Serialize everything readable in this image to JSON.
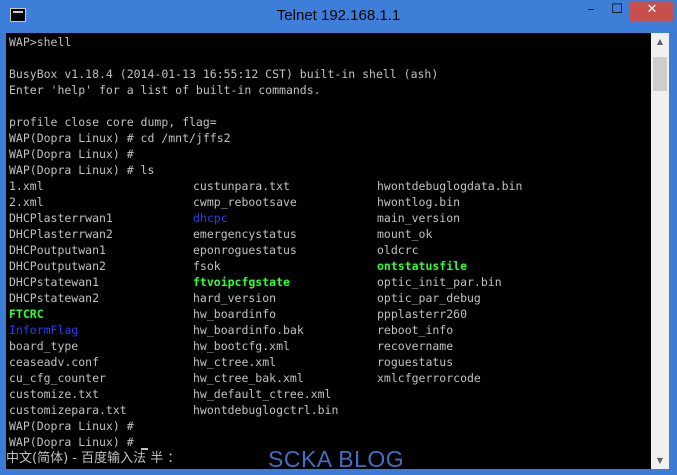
{
  "window": {
    "title": "Telnet 192.168.1.1",
    "minimize_label": "–",
    "maximize_label": "☐",
    "close_label": "✕"
  },
  "terminal": {
    "header_lines": [
      "WAP>shell",
      "",
      "BusyBox v1.18.4 (2014-01-13 16:55:12 CST) built-in shell (ash)",
      "Enter 'help' for a list of built-in commands.",
      "",
      "profile close core dump, flag=",
      "WAP(Dopra Linux) # cd /mnt/jffs2",
      "WAP(Dopra Linux) #",
      "WAP(Dopra Linux) # ls"
    ],
    "listing": [
      [
        {
          "t": "1.xml",
          "c": ""
        },
        {
          "t": "custunpara.txt",
          "c": ""
        },
        {
          "t": "hwontdebuglogdata.bin",
          "c": ""
        }
      ],
      [
        {
          "t": "2.xml",
          "c": ""
        },
        {
          "t": "cwmp_rebootsave",
          "c": ""
        },
        {
          "t": "hwontlog.bin",
          "c": ""
        }
      ],
      [
        {
          "t": "DHCPlasterrwan1",
          "c": ""
        },
        {
          "t": "dhcpc",
          "c": "blue"
        },
        {
          "t": "main_version",
          "c": ""
        }
      ],
      [
        {
          "t": "DHCPlasterrwan2",
          "c": ""
        },
        {
          "t": "emergencystatus",
          "c": ""
        },
        {
          "t": "mount_ok",
          "c": ""
        }
      ],
      [
        {
          "t": "DHCPoutputwan1",
          "c": ""
        },
        {
          "t": "eponroguestatus",
          "c": ""
        },
        {
          "t": "oldcrc",
          "c": ""
        }
      ],
      [
        {
          "t": "DHCPoutputwan2",
          "c": ""
        },
        {
          "t": "fsok",
          "c": ""
        },
        {
          "t": "ontstatusfile",
          "c": "green"
        }
      ],
      [
        {
          "t": "DHCPstatewan1",
          "c": ""
        },
        {
          "t": "ftvoipcfgstate",
          "c": "green"
        },
        {
          "t": "optic_init_par.bin",
          "c": ""
        }
      ],
      [
        {
          "t": "DHCPstatewan2",
          "c": ""
        },
        {
          "t": "hard_version",
          "c": ""
        },
        {
          "t": "optic_par_debug",
          "c": ""
        }
      ],
      [
        {
          "t": "FTCRC",
          "c": "green"
        },
        {
          "t": "hw_boardinfo",
          "c": ""
        },
        {
          "t": "ppplasterr260",
          "c": ""
        }
      ],
      [
        {
          "t": "InformFlag",
          "c": "blue"
        },
        {
          "t": "hw_boardinfo.bak",
          "c": ""
        },
        {
          "t": "reboot_info",
          "c": ""
        }
      ],
      [
        {
          "t": "board_type",
          "c": ""
        },
        {
          "t": "hw_bootcfg.xml",
          "c": ""
        },
        {
          "t": "recovername",
          "c": ""
        }
      ],
      [
        {
          "t": "ceaseadv.conf",
          "c": ""
        },
        {
          "t": "hw_ctree.xml",
          "c": ""
        },
        {
          "t": "roguestatus",
          "c": ""
        }
      ],
      [
        {
          "t": "cu_cfg_counter",
          "c": ""
        },
        {
          "t": "hw_ctree_bak.xml",
          "c": ""
        },
        {
          "t": "xmlcfgerrorcode",
          "c": ""
        }
      ],
      [
        {
          "t": "customize.txt",
          "c": ""
        },
        {
          "t": "hw_default_ctree.xml",
          "c": ""
        },
        {
          "t": "",
          "c": ""
        }
      ],
      [
        {
          "t": "customizepara.txt",
          "c": ""
        },
        {
          "t": "hwontdebuglogctrl.bin",
          "c": ""
        },
        {
          "t": "",
          "c": ""
        }
      ]
    ],
    "footer_lines": [
      "WAP(Dopra Linux) #",
      "WAP(Dopra Linux) #"
    ],
    "colors": {
      "default": "#c0c0c0",
      "blue": "#1f3fff",
      "green": "#30ff30",
      "background": "#000000"
    }
  },
  "ime_bar": {
    "text": "中文(简体) - 百度输入法 半 ："
  },
  "watermark": {
    "text": "SCKA BLOG"
  },
  "scrollbar": {
    "up_icon": "▲",
    "down_icon": "▼"
  }
}
